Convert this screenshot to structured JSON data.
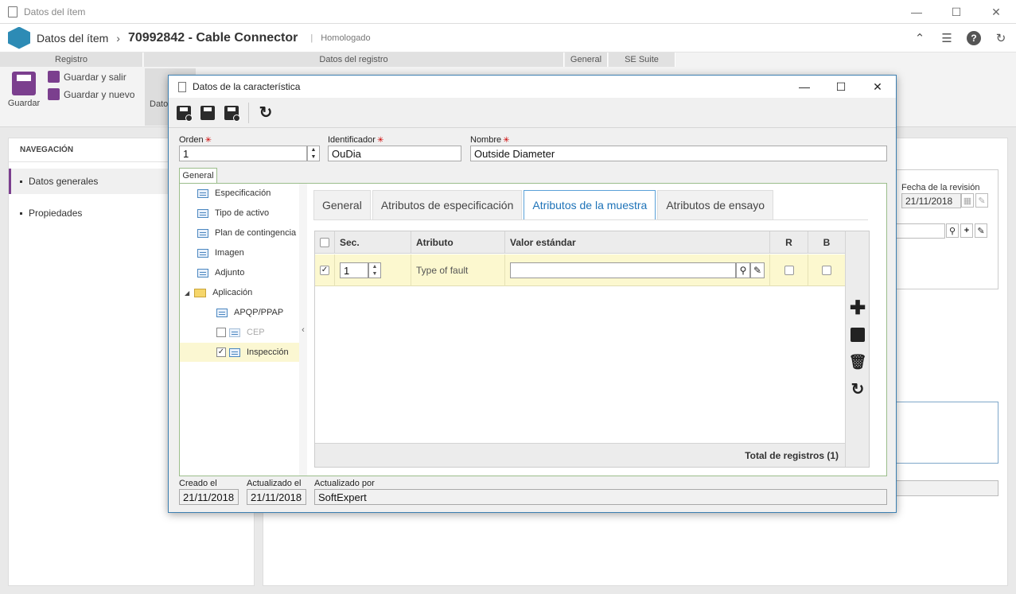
{
  "window": {
    "title": "Datos del ítem"
  },
  "header": {
    "title": "Datos del ítem",
    "item": "70992842 - Cable Connector",
    "status": "Homologado"
  },
  "ribbon": {
    "groups": [
      "Registro",
      "Datos del registro",
      "General",
      "SE Suite"
    ],
    "save_label": "Guardar",
    "save_exit_label": "Guardar y salir",
    "save_new_label": "Guardar y nuevo",
    "datos_label": "Dato"
  },
  "nav": {
    "heading": "NAVEGACIÓN",
    "items": [
      {
        "label": "Datos generales",
        "active": true
      },
      {
        "label": "Propiedades",
        "active": false
      }
    ]
  },
  "background": {
    "revision_label": "Fecha de la revisión",
    "revision_date": "21/11/2018"
  },
  "dialog": {
    "title": "Datos de la característica",
    "fields": {
      "orden_label": "Orden",
      "orden_value": "1",
      "id_label": "Identificador",
      "id_value": "OuDia",
      "name_label": "Nombre",
      "name_value": "Outside Diameter"
    },
    "section_tab": "General",
    "tree": [
      {
        "label": "Especificación",
        "kind": "item"
      },
      {
        "label": "Tipo de activo",
        "kind": "item"
      },
      {
        "label": "Plan de contingencia",
        "kind": "item"
      },
      {
        "label": "Imagen",
        "kind": "item"
      },
      {
        "label": "Adjunto",
        "kind": "item"
      },
      {
        "label": "Aplicación",
        "kind": "folder"
      },
      {
        "label": "APQP/PPAP",
        "kind": "child"
      },
      {
        "label": "CEP",
        "kind": "child-check",
        "checked": false,
        "disabled": true
      },
      {
        "label": "Inspección",
        "kind": "child-check",
        "checked": true,
        "selected": true
      }
    ],
    "tabs": [
      {
        "label": "General",
        "active": false
      },
      {
        "label": "Atributos de especificación",
        "active": false
      },
      {
        "label": "Atributos de la muestra",
        "active": true
      },
      {
        "label": "Atributos de ensayo",
        "active": false
      }
    ],
    "grid": {
      "columns": [
        "Sec.",
        "Atributo",
        "Valor estándar",
        "R",
        "B"
      ],
      "rows": [
        {
          "checked": true,
          "seq": "1",
          "attribute": "Type of fault",
          "value": "",
          "r": false,
          "b": false
        }
      ],
      "footer": "Total de registros (1)"
    },
    "footer": {
      "created_label": "Creado el",
      "created_value": "21/11/2018",
      "updated_label": "Actualizado el",
      "updated_value": "21/11/2018",
      "updated_by_label": "Actualizado por",
      "updated_by_value": "SoftExpert"
    }
  }
}
